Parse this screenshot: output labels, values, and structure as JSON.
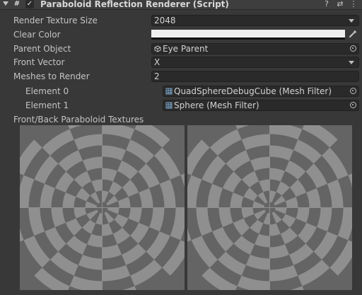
{
  "header": {
    "title": "Paraboloid Reflection Renderer (Script)",
    "icons": [
      "foldout-arrow-icon",
      "script-icon",
      "checkbox-icon",
      "help-icon",
      "preset-icon",
      "more-icon"
    ],
    "help_glyph": "?",
    "preset_glyph": "⇄",
    "more_glyph": "⋮",
    "enabled_glyph": "✓"
  },
  "properties": {
    "render_texture_size": {
      "label": "Render Texture Size",
      "value": "2048"
    },
    "clear_color": {
      "label": "Clear Color",
      "color": "#eeeeee"
    },
    "parent_object": {
      "label": "Parent Object",
      "value": "Eye Parent",
      "icon": "gameobject-icon"
    },
    "front_vector": {
      "label": "Front Vector",
      "value": "X"
    },
    "meshes_to_render": {
      "label": "Meshes to Render",
      "count": "2",
      "elements": [
        {
          "label": "Element 0",
          "value": "QuadSphereDebugCube (Mesh Filter)",
          "icon": "mesh-filter-icon"
        },
        {
          "label": "Element 1",
          "value": "Sphere (Mesh Filter)",
          "icon": "mesh-filter-icon"
        }
      ]
    },
    "textures": {
      "label": "Front/Back Paraboloid Textures"
    }
  },
  "colors": {
    "background": "#383838",
    "field": "#2a2a2a",
    "texture_dark": "#646464",
    "texture_light": "#8f8f8f"
  }
}
